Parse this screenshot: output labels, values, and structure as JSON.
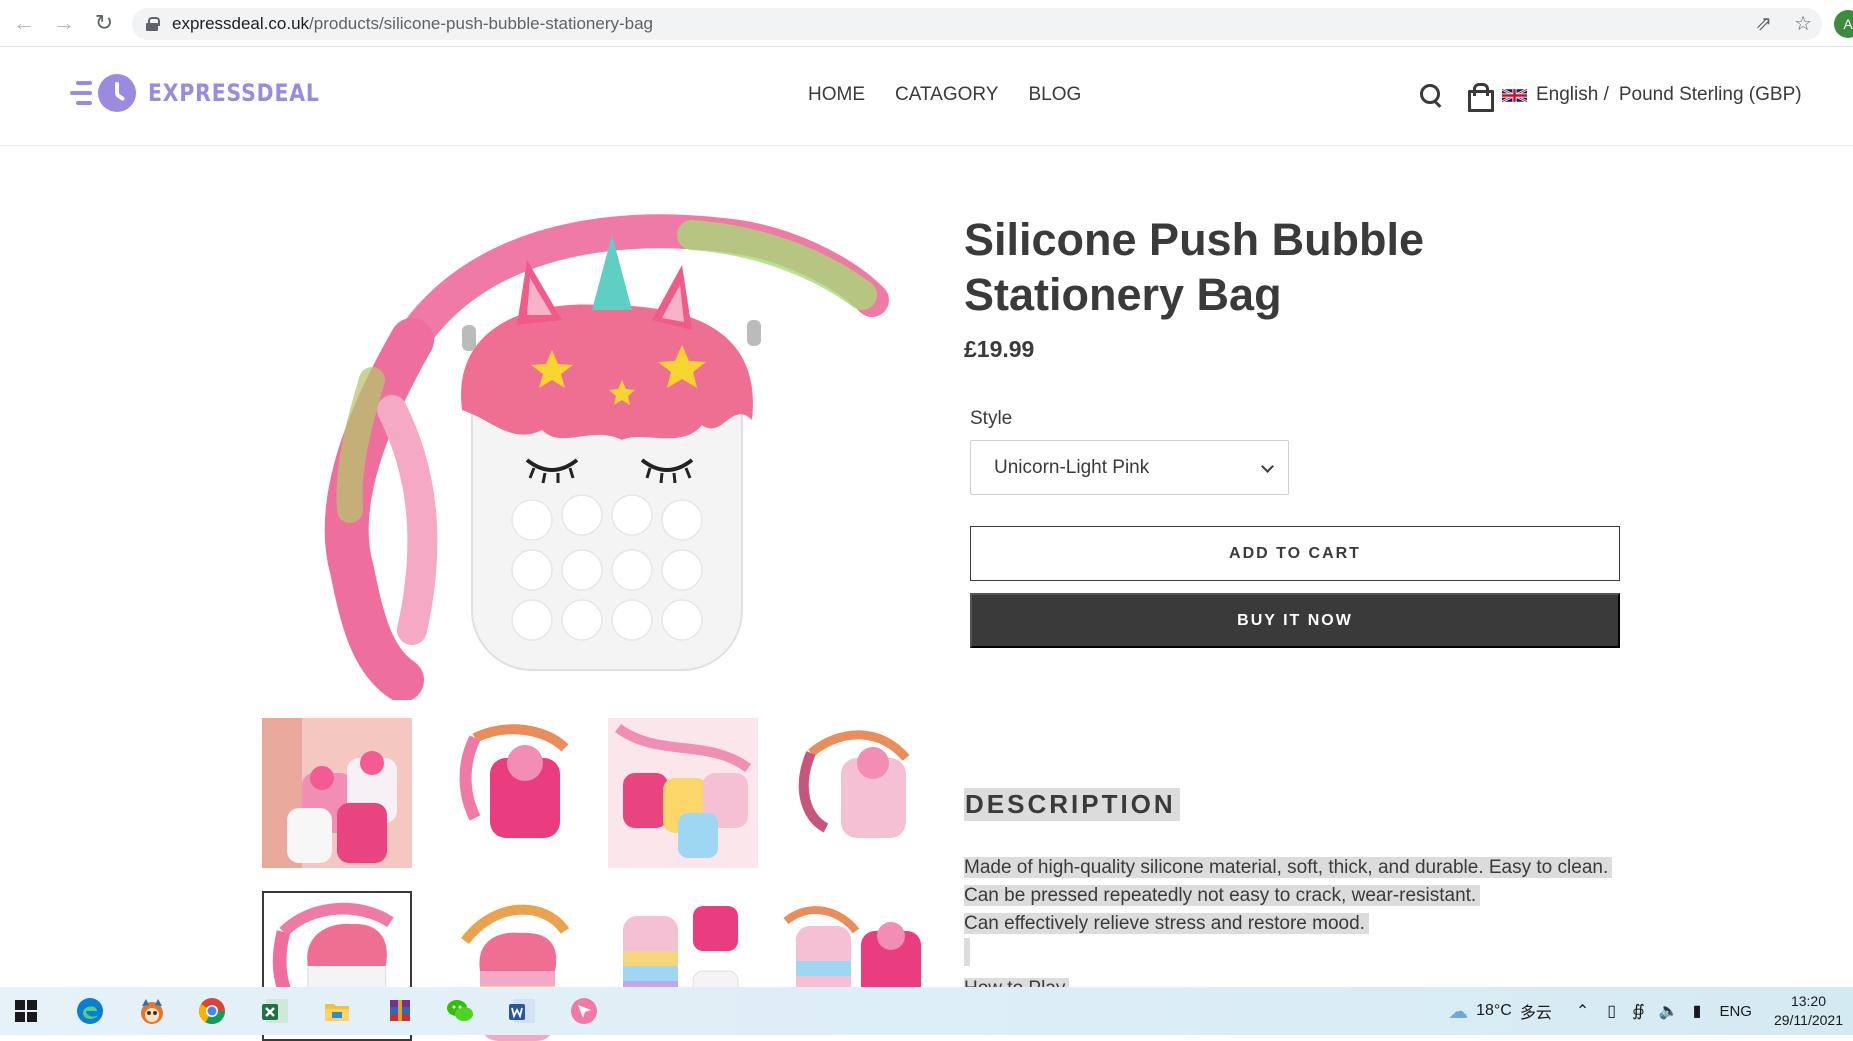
{
  "browser": {
    "url_domain": "expressdeal.co.uk",
    "url_path": "/products/silicone-push-bubble-stationery-bag",
    "profile_initial": "A",
    "icons": [
      "back-arrow-icon",
      "forward-arrow-icon",
      "reload-icon",
      "lock-icon",
      "share-icon",
      "star-icon"
    ]
  },
  "header": {
    "logo_text": "EXPRESSDEAL",
    "nav": [
      "HOME",
      "CATAGORY",
      "BLOG"
    ],
    "language": "English /",
    "currency": "Pound Sterling (GBP)",
    "icons": [
      "search-icon",
      "cart-icon",
      "uk-flag-icon"
    ]
  },
  "product": {
    "title": "Silicone Push Bubble Stationery Bag",
    "price": "£19.99",
    "style_label": "Style",
    "style_value": "Unicorn-Light Pink",
    "add_to_cart_label": "ADD TO CART",
    "buy_now_label": "BUY IT NOW",
    "thumbnails": [
      {
        "name": "thumb-group-pink-bags"
      },
      {
        "name": "thumb-hot-pink-bag"
      },
      {
        "name": "thumb-multi-bags"
      },
      {
        "name": "thumb-pink-bag-strap"
      },
      {
        "name": "thumb-white-unicorn-bag"
      },
      {
        "name": "thumb-rainbow-bag"
      },
      {
        "name": "thumb-rainbow-and-pink-bags"
      },
      {
        "name": "thumb-two-bags"
      }
    ],
    "active_thumbnail": 4
  },
  "description": {
    "heading": "DESCRIPTION",
    "lines": [
      "Made of high-quality silicone material, soft, thick, and durable. Easy to clean.",
      "Can be pressed repeatedly not easy to crack, wear-resistant.",
      "Can effectively relieve stress and restore mood.",
      "",
      "How to Play"
    ]
  },
  "taskbar": {
    "weather_temp": "18°C",
    "weather_text": "多云",
    "lang_indicator": "ENG",
    "time": "13:20",
    "date": "29/11/2021",
    "colors": {
      "edge": "#0c7cd5",
      "chrome_red": "#db4437",
      "excel": "#1f7244",
      "word": "#2b579a",
      "wechat": "#2dc100"
    }
  }
}
